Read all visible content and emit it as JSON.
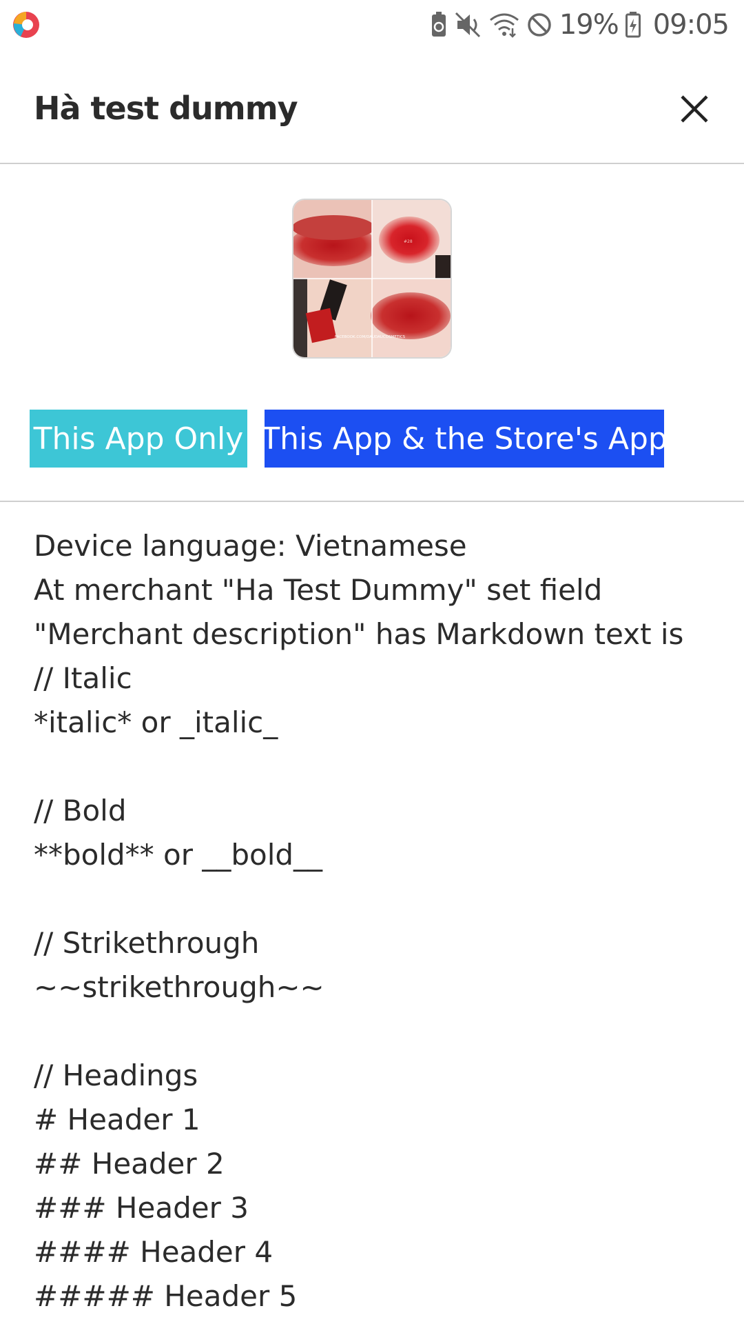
{
  "status_bar": {
    "battery_percent": "19%",
    "time": "09:05",
    "icons": [
      "app-logo-icon",
      "recycle-icon",
      "mute-icon",
      "wifi-icon",
      "do-not-disturb-icon",
      "battery-icon"
    ]
  },
  "header": {
    "title": "Hà test dummy",
    "close_icon": "close-icon"
  },
  "thumbnail": {
    "caption": "FACEBOOK.COM/DAUDAUCOSMETICS",
    "tag": "#28"
  },
  "buttons": {
    "this_app_only": "This App Only",
    "this_app_and_store": "This App & the Store's App",
    "colors": {
      "this_app_only": "#3dc6d6",
      "this_app_and_store": "#1c4ff2"
    }
  },
  "description": {
    "lines": [
      "Device language: Vietnamese",
      "At merchant \"Ha Test Dummy\" set field",
      "\"Merchant description\" has Markdown text is",
      "// Italic",
      "*italic* or _italic_",
      "",
      "// Bold",
      "**bold** or __bold__",
      "",
      "// Strikethrough",
      "~~strikethrough~~",
      "",
      "// Headings",
      "# Header 1",
      "## Header 2",
      "### Header 3",
      "#### Header 4",
      "##### Header 5"
    ]
  }
}
